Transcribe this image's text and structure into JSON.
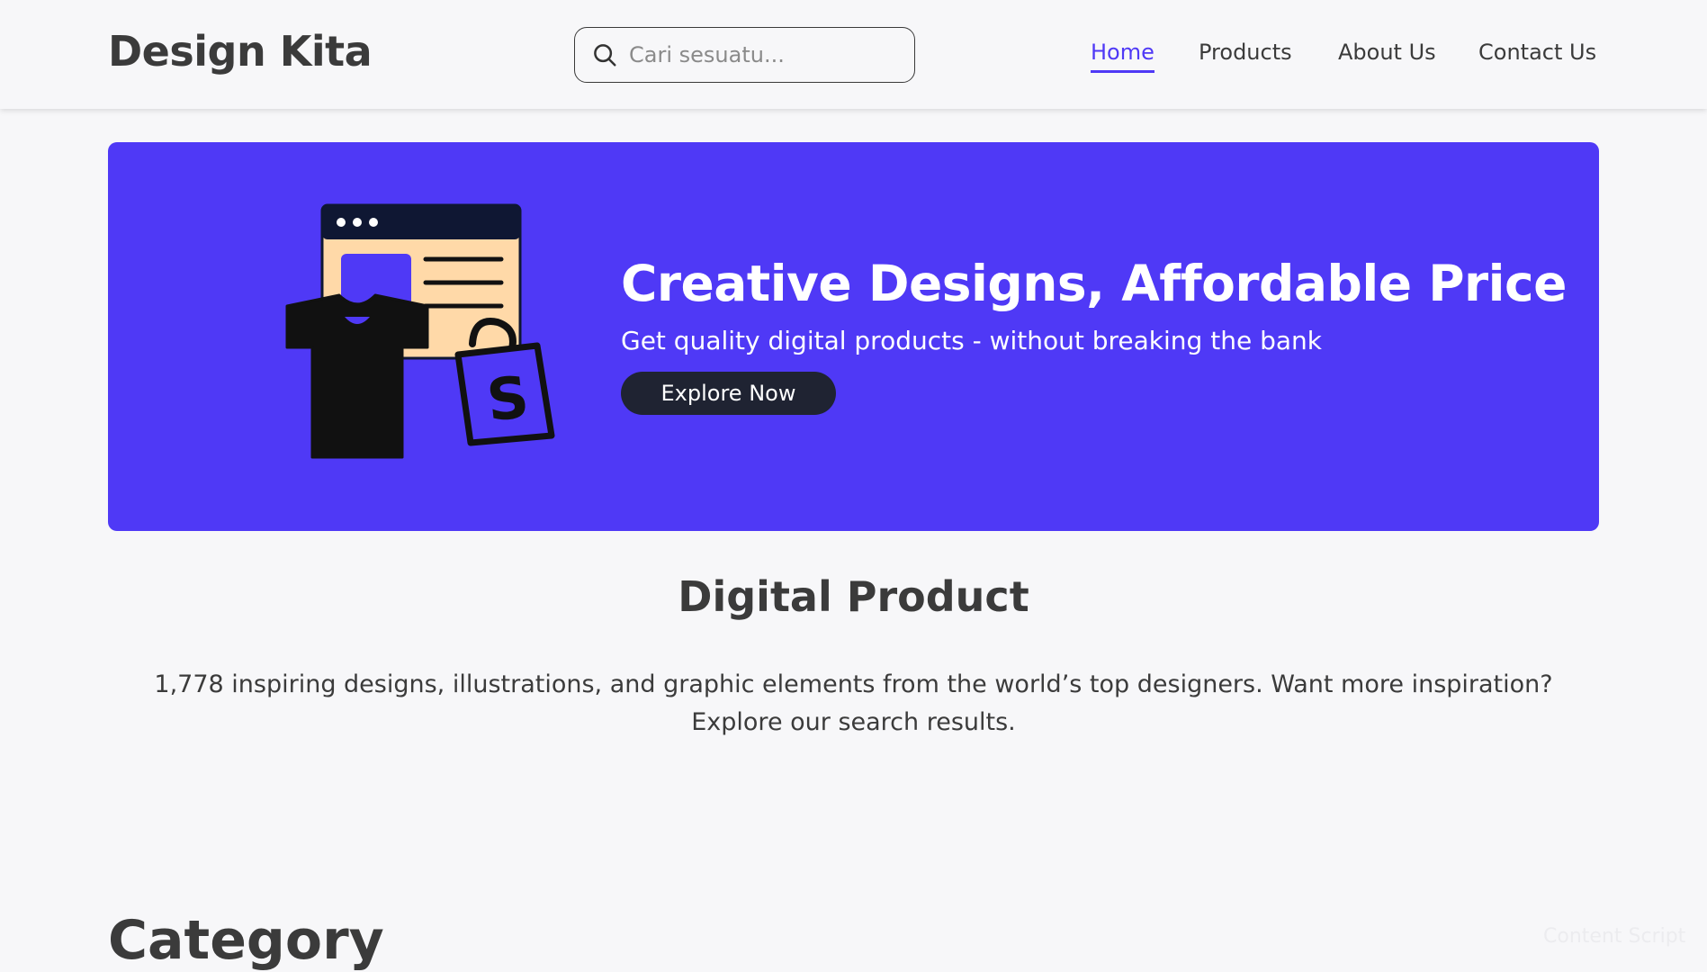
{
  "brand": {
    "name": "Design Kita"
  },
  "search": {
    "placeholder": "Cari sesuatu..."
  },
  "nav": {
    "items": [
      {
        "label": "Home",
        "active": true
      },
      {
        "label": "Products",
        "active": false
      },
      {
        "label": "About Us",
        "active": false
      },
      {
        "label": "Contact Us",
        "active": false
      }
    ]
  },
  "hero": {
    "title": "Creative Designs, Affordable Price",
    "subtitle": "Get quality digital products - without breaking the bank",
    "cta_label": "Explore Now",
    "illustration_icon": "tshirt-browser-shopping-bag-icon"
  },
  "section": {
    "title": "Digital Product",
    "description": "1,778 inspiring designs, illustrations, and graphic elements from the world’s top designers. Want more inspiration? Explore our search results."
  },
  "category": {
    "title": "Category"
  },
  "watermark": {
    "text": "Content Script"
  },
  "colors": {
    "accent": "#4f39f6",
    "hero_background": "#4f39f6",
    "button_background": "#1f2332",
    "page_background": "#f7f7f9",
    "text": "#3b3b3b"
  }
}
